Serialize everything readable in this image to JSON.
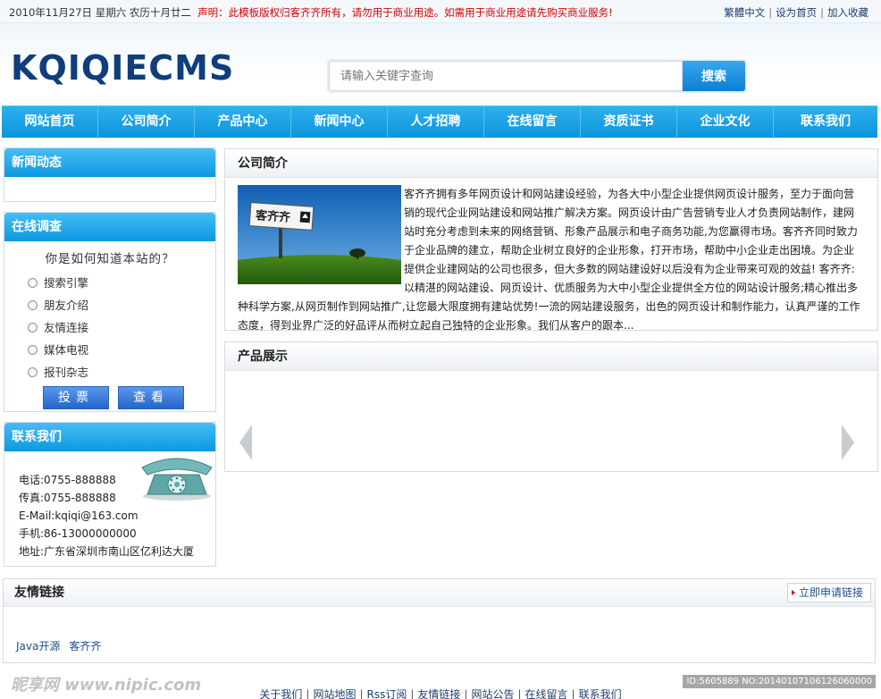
{
  "topbar": {
    "date": "2010年11月27日 星期六 农历十月廿二",
    "notice": "声明：此模板版权归客齐齐所有，请勿用于商业用途。如需用于商业用途请先购买商业服务!",
    "links": [
      "繁體中文",
      "设为首页",
      "加入收藏"
    ]
  },
  "header": {
    "logo": "KQIQIECMS",
    "search_placeholder": "请输入关键字查询",
    "search_button": "搜索"
  },
  "nav": [
    "网站首页",
    "公司简介",
    "产品中心",
    "新闻中心",
    "人才招聘",
    "在线留言",
    "资质证书",
    "企业文化",
    "联系我们"
  ],
  "news": {
    "title": "新闻动态"
  },
  "poll": {
    "title": "在线调查",
    "question": "你是如何知道本站的？",
    "options": [
      "搜索引擎",
      "朋友介绍",
      "友情连接",
      "媒体电视",
      "报刊杂志"
    ],
    "vote_button": "投票",
    "view_button": "查看"
  },
  "contact": {
    "title": "联系我们",
    "phone": "电话:0755-888888",
    "fax": "传真:0755-888888",
    "email": "E-Mail:kqiqi@163.com",
    "mobile": "手机:86-13000000000",
    "address": "地址:广东省深圳市南山区亿利达大厦"
  },
  "about": {
    "title": "公司简介",
    "billboard_text": "客齐齐",
    "text": "客齐齐拥有多年网页设计和网站建设经验，为各大中小型企业提供网页设计服务，至力于面向营销的现代企业网站建设和网站推广解决方案。网页设计由广告营销专业人才负责网站制作，建网站时充分考虑到未来的网络营销、形象产品展示和电子商务功能,为您赢得市场。客齐齐同时致力于企业品牌的建立，帮助企业树立良好的企业形象，打开市场，帮助中小企业走出困境。为企业提供企业建网站的公司也很多，但大多数的网站建设好以后没有为企业带来可观的效益! 客齐齐:以精湛的网站建设、网页设计、优质服务为大中小型企业提供全方位的网站设计服务;精心推出多种科学方案,从网页制作到网站推广,让您最大限度拥有建站优势!一流的网站建设服务，出色的网页设计和制作能力，认真严谨的工作态度，得到业界广泛的好品评从而树立起自己独特的企业形象。我们从客户的跟本..."
  },
  "products": {
    "title": "产品展示"
  },
  "friend_links": {
    "title": "友情链接",
    "apply": "立即申请链接",
    "links": [
      "Java开源",
      "客齐齐"
    ]
  },
  "footer": {
    "links": [
      "关于我们",
      "网站地图",
      "Rss订阅",
      "友情链接",
      "网站公告",
      "在线留言",
      "联系我们"
    ]
  },
  "watermark": {
    "site": "昵享网 www.nipic.com",
    "id": "ID:5605889 NO:20140107106126060000"
  }
}
